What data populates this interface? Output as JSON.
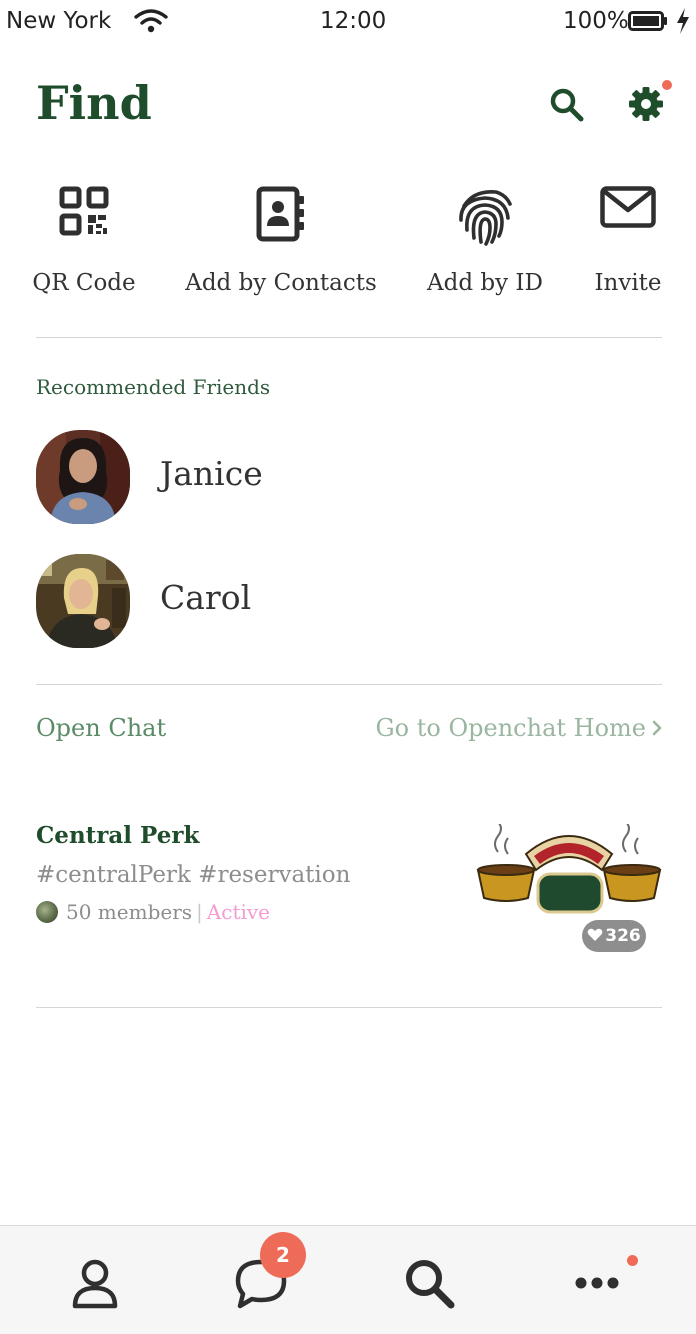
{
  "status_bar": {
    "carrier": "New York",
    "time": "12:00",
    "battery": "100%"
  },
  "header": {
    "title": "Find"
  },
  "actions": [
    {
      "label": "QR Code",
      "icon": "qr-code-icon"
    },
    {
      "label": "Add by Contacts",
      "icon": "contacts-book-icon"
    },
    {
      "label": "Add by ID",
      "icon": "fingerprint-icon"
    },
    {
      "label": "Invite",
      "icon": "envelope-icon"
    }
  ],
  "recommended": {
    "title": "Recommended Friends",
    "friends": [
      {
        "name": "Janice"
      },
      {
        "name": "Carol"
      }
    ]
  },
  "open_chat": {
    "title": "Open Chat",
    "link": "Go to Openchat Home",
    "card": {
      "name": "Central Perk",
      "tags": "#centralPerk #reservation",
      "members": "50 members",
      "status": "Active",
      "likes": "326"
    }
  },
  "bottom_nav": {
    "chat_badge": "2"
  },
  "colors": {
    "brand_green": "#1f4d2c",
    "badge_red": "#ee6b57",
    "active_pink": "#f49bd4"
  }
}
